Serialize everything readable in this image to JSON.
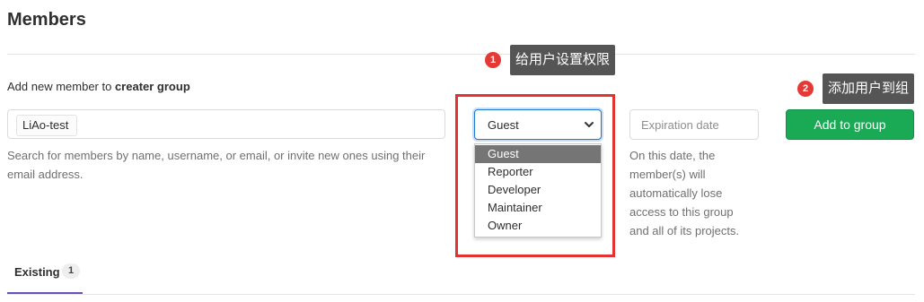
{
  "page_title": "Members",
  "add_member": {
    "label_prefix": "Add new member to ",
    "group_name": "creater group",
    "selected_user": "LiAo-test",
    "help_text": "Search for members by name, username, or email, or invite new ones using their email address."
  },
  "role": {
    "selected": "Guest",
    "options": [
      "Guest",
      "Reporter",
      "Developer",
      "Maintainer",
      "Owner"
    ]
  },
  "expiration": {
    "placeholder": "Expiration date",
    "help_text": "On this date, the member(s) will automatically lose access to this group and all of its projects."
  },
  "add_button_label": "Add to group",
  "annotations": [
    {
      "number": "1",
      "text": "给用户设置权限"
    },
    {
      "number": "2",
      "text": "添加用户到组"
    }
  ],
  "tabs": [
    {
      "label": "Existing",
      "count": "1"
    }
  ],
  "colors": {
    "primary_green": "#1aaa55",
    "focus_blue": "#1f78d1",
    "highlight_red": "#e23232",
    "tab_accent": "#6b4fbb"
  }
}
